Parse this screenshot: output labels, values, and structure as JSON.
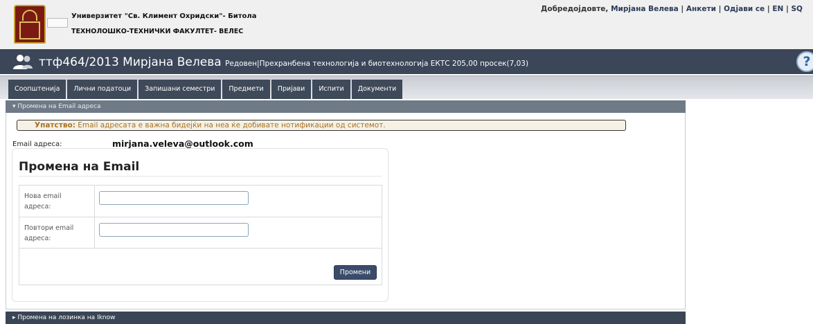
{
  "header": {
    "university": "Универзитет \"Св. Климент Охридски\"- Битола",
    "faculty": "ТЕХНОЛОШКО-ТЕХНИЧКИ ФАКУЛТЕТ- ВЕЛЕС",
    "welcome": "Добредојдовте,",
    "user_link": "Мирјана Велева",
    "separator": "|",
    "surveys": "Анкети",
    "logout": "Одјави се",
    "lang_en": "EN",
    "lang_sq": "SQ"
  },
  "student": {
    "title": "ттф464/2013 Мирјана Велева",
    "details": "Редовен|Прехранбена технологија и биотехнологија ЕКТС 205,00 просек(7,03)"
  },
  "tabs": [
    {
      "label": "Соопштенија"
    },
    {
      "label": "Лични податоци"
    },
    {
      "label": "Запишани семестри"
    },
    {
      "label": "Предмети"
    },
    {
      "label": "Пријави"
    },
    {
      "label": "Испити"
    },
    {
      "label": "Документи"
    }
  ],
  "email_panel": {
    "header": "▾ Промена на Email адреса",
    "notice_bold": "Упатство:",
    "notice_text": "Email адресата е важна бидејќи на неа ќе добивате нотификации од системот.",
    "current_label": "Email адреса:",
    "current_value": "mirjana.veleva@outlook.com",
    "form_title": "Промена на Email",
    "new_email_label": "Нова email адреса:",
    "new_email_value": "",
    "repeat_email_label": "Повтори email адреса:",
    "repeat_email_value": "",
    "submit": "Промени"
  },
  "password_panel": {
    "header": "▸ Промена на лозинка на Iknow"
  },
  "colors": {
    "dark_bar": "#3b4658",
    "tab_bg": "#3e4959",
    "panel_header": "#6f7a87",
    "notice_text": "#a87226"
  }
}
